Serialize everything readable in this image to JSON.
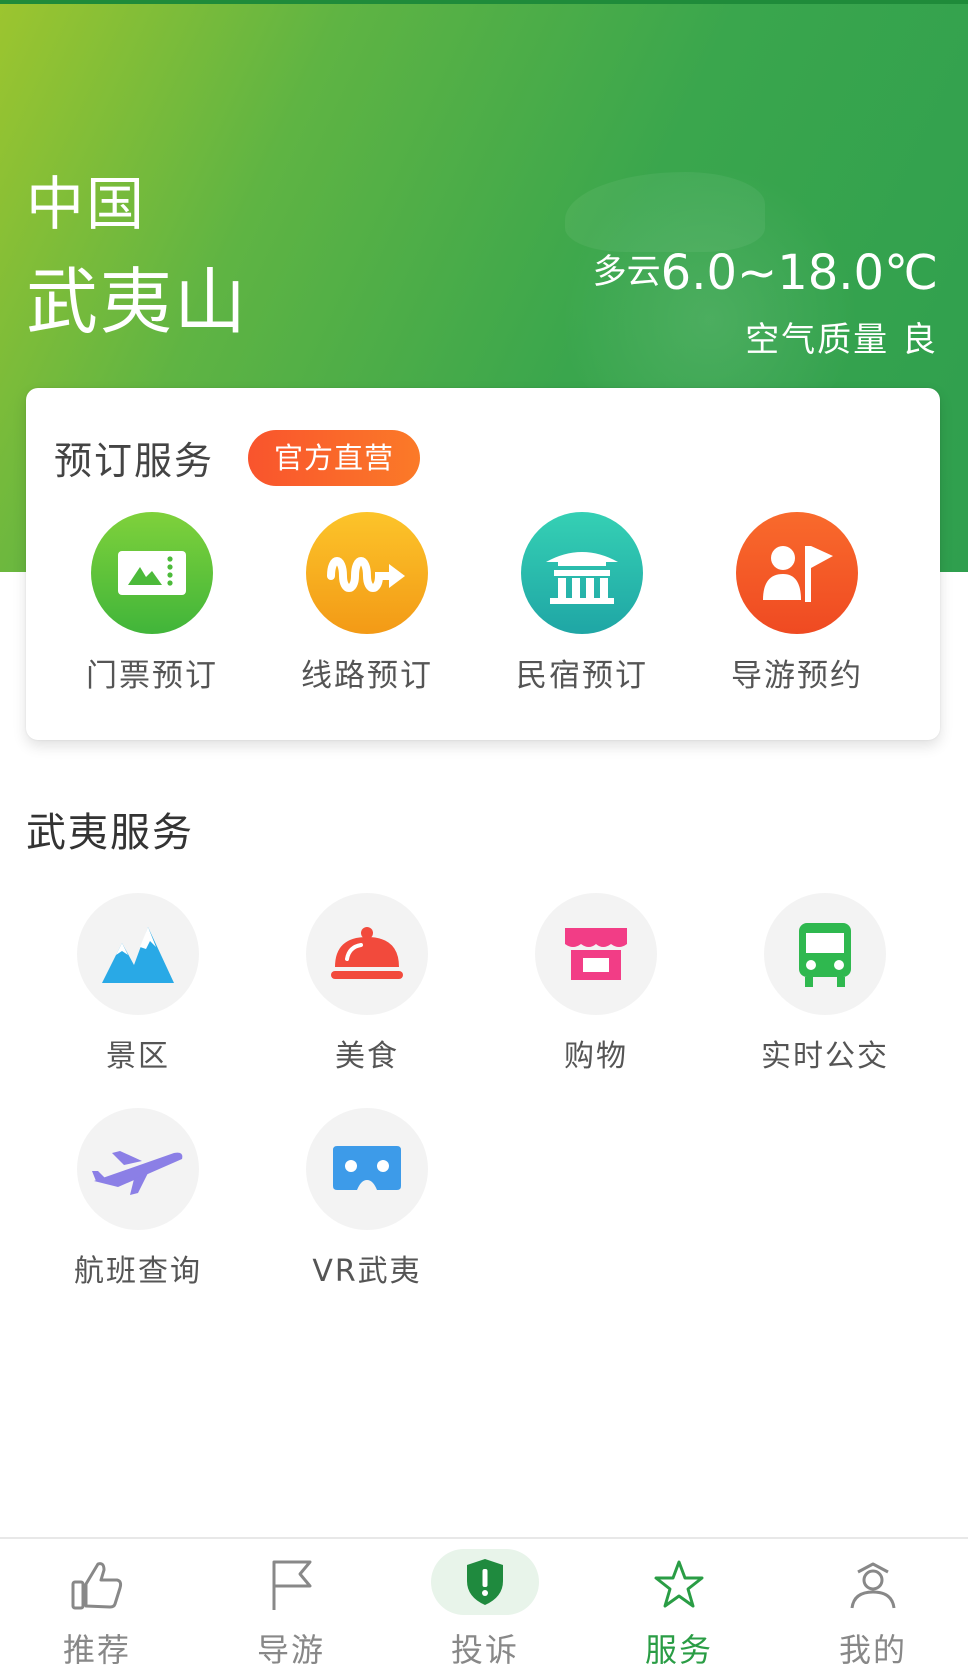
{
  "hero": {
    "country": "中国",
    "city": "武夷山",
    "weather_condition": "多云",
    "temperature": "6.0~18.0℃",
    "air_quality": "空气质量  良"
  },
  "booking": {
    "title": "预订服务",
    "badge": "官方直营",
    "items": [
      {
        "label": "门票预订",
        "icon": "ticket-icon",
        "color": "#5fc43a"
      },
      {
        "label": "线路预订",
        "icon": "route-icon",
        "color": "#f7a51d"
      },
      {
        "label": "民宿预订",
        "icon": "house-icon",
        "color": "#2bbfae"
      },
      {
        "label": "导游预约",
        "icon": "guide-flag-icon",
        "color": "#f4582a"
      }
    ]
  },
  "services": {
    "title": "武夷服务",
    "items": [
      {
        "label": "景区",
        "icon": "mountain-icon"
      },
      {
        "label": "美食",
        "icon": "food-cloche-icon"
      },
      {
        "label": "购物",
        "icon": "shop-icon"
      },
      {
        "label": "实时公交",
        "icon": "bus-icon"
      },
      {
        "label": "航班查询",
        "icon": "airplane-icon"
      },
      {
        "label": "VR武夷",
        "icon": "vr-glasses-icon"
      }
    ]
  },
  "tabbar": {
    "tabs": [
      {
        "label": "推荐",
        "icon": "thumbs-up-icon"
      },
      {
        "label": "导游",
        "icon": "flag-icon"
      },
      {
        "label": "投诉",
        "icon": "shield-icon"
      },
      {
        "label": "服务",
        "icon": "star-icon",
        "active": true
      },
      {
        "label": "我的",
        "icon": "user-icon"
      }
    ]
  },
  "colors": {
    "accent_green": "#2a9d45",
    "badge_orange": "#f9542d"
  }
}
